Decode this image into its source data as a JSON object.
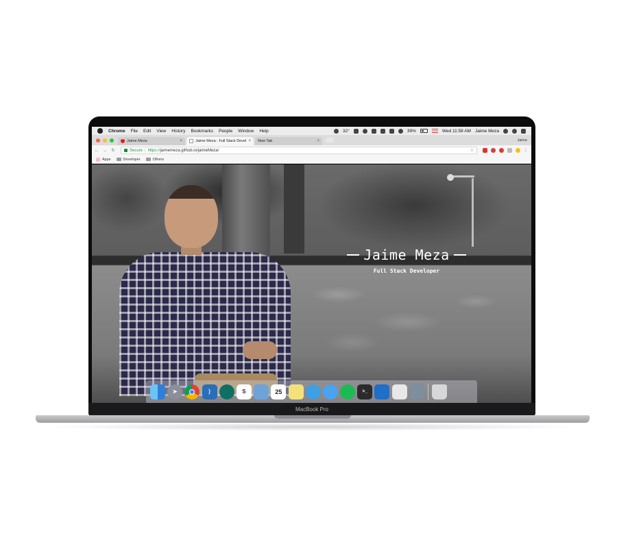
{
  "menubar": {
    "app_name": "Chrome",
    "items": [
      "File",
      "Edit",
      "View",
      "History",
      "Bookmarks",
      "People",
      "Window",
      "Help"
    ],
    "temperature": "32°",
    "battery": "39%",
    "clock": "Wed 11:58 AM",
    "user": "Jaime Meza"
  },
  "browser": {
    "tabs": [
      {
        "title": "Jaime Meza",
        "favicon": "angular-icon",
        "active": false
      },
      {
        "title": "Jaime Meza - Full Stack Devel",
        "favicon": "page-icon",
        "active": true
      },
      {
        "title": "New Tab",
        "favicon": "",
        "active": false
      }
    ],
    "profile_name": "Jaime",
    "secure_label": "Secure",
    "url_scheme": "https://",
    "url_rest": "jaimemeza.github.io/jaimeMeza/",
    "bookmarks": [
      {
        "label": "Apps",
        "icon": "apps-grid-icon"
      },
      {
        "label": "Developer",
        "icon": "folder-icon"
      },
      {
        "label": "Others",
        "icon": "folder-icon"
      }
    ]
  },
  "page": {
    "title": "Jaime Meza",
    "subtitle": "Full Stack Developer"
  },
  "dock": {
    "apps": [
      {
        "name": "finder-icon",
        "color": "#3d8ee8"
      },
      {
        "name": "launchpad-icon",
        "color": "#8a8f99"
      },
      {
        "name": "chrome-icon",
        "color": "#e8b53a"
      },
      {
        "name": "vscode-icon",
        "color": "#2a6fb5"
      },
      {
        "name": "gitkraken-icon",
        "color": "#1a8f7d"
      },
      {
        "name": "slack-icon",
        "color": "#ffffff"
      },
      {
        "name": "preview-icon",
        "color": "#6ea3d8"
      },
      {
        "name": "calendar-icon",
        "color": "#ffffff"
      },
      {
        "name": "notes-icon",
        "color": "#f3e27a"
      },
      {
        "name": "tweetbot-icon",
        "color": "#3ea0e0"
      },
      {
        "name": "messages-icon",
        "color": "#4aa3f0"
      },
      {
        "name": "spotify-icon",
        "color": "#1db954"
      },
      {
        "name": "terminal-icon",
        "color": "#2b2b2b"
      },
      {
        "name": "trello-icon",
        "color": "#1f6ec7"
      },
      {
        "name": "textedit-icon",
        "color": "#e8e8e8"
      },
      {
        "name": "image-capture-icon",
        "color": "#7d8e9e"
      },
      {
        "name": "trash-icon",
        "color": "#d7d7d7"
      }
    ],
    "calendar_day": "25",
    "terminal_glyph": ">_",
    "slack_glyph": "S"
  },
  "laptop": {
    "model_label": "MacBook Pro"
  }
}
